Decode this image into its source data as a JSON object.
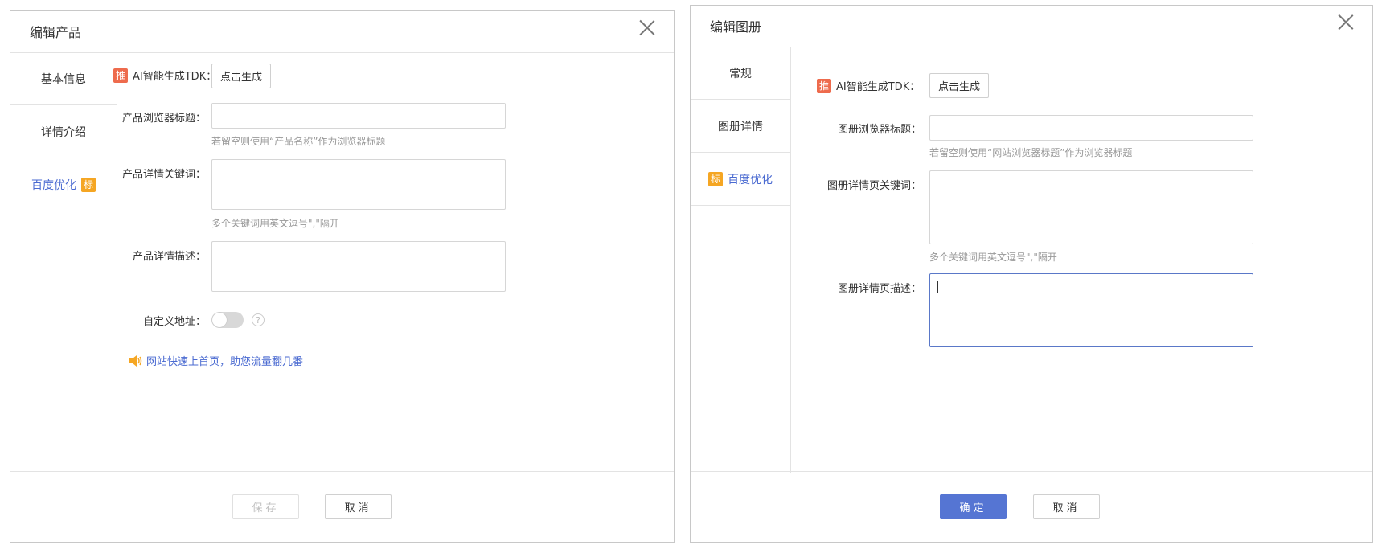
{
  "product_dialog": {
    "title": "编辑产品",
    "sidebar": [
      {
        "label": "基本信息"
      },
      {
        "label": "详情介绍"
      },
      {
        "label": "百度优化",
        "badge": "标"
      }
    ],
    "ai_badge": "推",
    "ai_label": "AI智能生成TDK：",
    "generate_button": "点击生成",
    "browser_title_label": "产品浏览器标题：",
    "browser_title_value": "",
    "browser_title_hint": "若留空则使用“产品名称”作为浏览器标题",
    "keywords_label": "产品详情关键词：",
    "keywords_value": "",
    "keywords_hint": "多个关键词用英文逗号\",\"隔开",
    "description_label": "产品详情描述：",
    "description_value": "",
    "custom_url_label": "自定义地址：",
    "help_glyph": "?",
    "promo_text": "网站快速上首页，助您流量翻几番",
    "save_button": "保存",
    "cancel_button": "取消"
  },
  "album_dialog": {
    "title": "编辑图册",
    "sidebar": [
      {
        "label": "常规"
      },
      {
        "label": "图册详情"
      },
      {
        "label": "百度优化",
        "badge": "标"
      }
    ],
    "ai_badge": "推",
    "ai_label": "AI智能生成TDK：",
    "generate_button": "点击生成",
    "browser_title_label": "图册浏览器标题：",
    "browser_title_value": "",
    "browser_title_hint": "若留空则使用“网站浏览器标题”作为浏览器标题",
    "keywords_label": "图册详情页关键词：",
    "keywords_value": "",
    "keywords_hint": "多个关键词用英文逗号\",\"隔开",
    "description_label": "图册详情页描述：",
    "description_value": "",
    "confirm_button": "确定",
    "cancel_button": "取消"
  },
  "colors": {
    "accent": "#4a6ad1",
    "primary_button": "#5575d3",
    "badge_orange": "#f5a623",
    "badge_red": "#ee6b4d",
    "border": "#d6d6d6"
  },
  "icons": {
    "close": "close-icon",
    "speaker": "speaker-icon",
    "help": "help-icon"
  }
}
